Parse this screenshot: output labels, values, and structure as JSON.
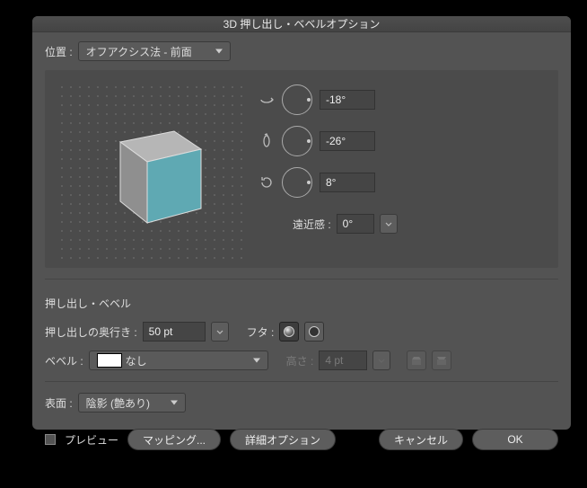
{
  "title": "3D 押し出し・ベベルオプション",
  "position": {
    "label": "位置 :",
    "value": "オフアクシス法 - 前面"
  },
  "rotation": {
    "x": "-18°",
    "y": "-26°",
    "z": "8°"
  },
  "perspective": {
    "label": "遠近感 :",
    "value": "0°"
  },
  "extrude": {
    "section": "押し出し・ベベル",
    "depth_label": "押し出しの奥行き :",
    "depth_value": "50 pt",
    "cap_label": "フタ :"
  },
  "bevel": {
    "label": "ベベル :",
    "value": "なし",
    "height_label": "高さ :",
    "height_value": "4 pt"
  },
  "surface": {
    "label": "表面 :",
    "value": "陰影 (艶あり)"
  },
  "buttons": {
    "preview": "プレビュー",
    "mapping": "マッピング...",
    "advanced": "詳細オプション",
    "cancel": "キャンセル",
    "ok": "OK"
  },
  "colors": {
    "cube_front": "#5fa9b3",
    "cube_top": "#b6b6b6",
    "cube_side": "#8f8f8f"
  }
}
